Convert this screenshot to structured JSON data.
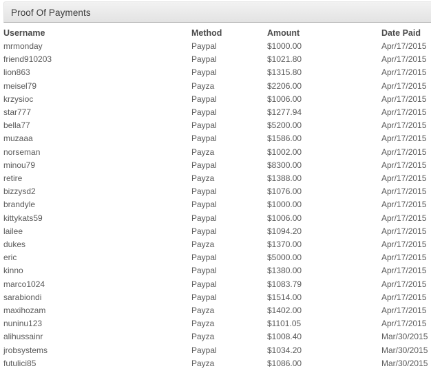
{
  "panel": {
    "title": "Proof Of Payments"
  },
  "table": {
    "headers": {
      "username": "Username",
      "method": "Method",
      "amount": "Amount",
      "date_paid": "Date Paid"
    },
    "rows": [
      {
        "username": "mrmonday",
        "method": "Paypal",
        "amount": "$1000.00",
        "date_paid": "Apr/17/2015"
      },
      {
        "username": "friend910203",
        "method": "Paypal",
        "amount": "$1021.80",
        "date_paid": "Apr/17/2015"
      },
      {
        "username": "lion863",
        "method": "Paypal",
        "amount": "$1315.80",
        "date_paid": "Apr/17/2015"
      },
      {
        "username": "meisel79",
        "method": "Payza",
        "amount": "$2206.00",
        "date_paid": "Apr/17/2015"
      },
      {
        "username": "krzysioc",
        "method": "Paypal",
        "amount": "$1006.00",
        "date_paid": "Apr/17/2015"
      },
      {
        "username": "star777",
        "method": "Paypal",
        "amount": "$1277.94",
        "date_paid": "Apr/17/2015"
      },
      {
        "username": "bella77",
        "method": "Paypal",
        "amount": "$5200.00",
        "date_paid": "Apr/17/2015"
      },
      {
        "username": "muzaaa",
        "method": "Paypal",
        "amount": "$1586.00",
        "date_paid": "Apr/17/2015"
      },
      {
        "username": "norseman",
        "method": "Payza",
        "amount": "$1002.00",
        "date_paid": "Apr/17/2015"
      },
      {
        "username": "minou79",
        "method": "Paypal",
        "amount": "$8300.00",
        "date_paid": "Apr/17/2015"
      },
      {
        "username": "retire",
        "method": "Payza",
        "amount": "$1388.00",
        "date_paid": "Apr/17/2015"
      },
      {
        "username": "bizzysd2",
        "method": "Paypal",
        "amount": "$1076.00",
        "date_paid": "Apr/17/2015"
      },
      {
        "username": "brandyle",
        "method": "Paypal",
        "amount": "$1000.00",
        "date_paid": "Apr/17/2015"
      },
      {
        "username": "kittykats59",
        "method": "Paypal",
        "amount": "$1006.00",
        "date_paid": "Apr/17/2015"
      },
      {
        "username": "lailee",
        "method": "Paypal",
        "amount": "$1094.20",
        "date_paid": "Apr/17/2015"
      },
      {
        "username": "dukes",
        "method": "Payza",
        "amount": "$1370.00",
        "date_paid": "Apr/17/2015"
      },
      {
        "username": "eric",
        "method": "Paypal",
        "amount": "$5000.00",
        "date_paid": "Apr/17/2015"
      },
      {
        "username": "kinno",
        "method": "Paypal",
        "amount": "$1380.00",
        "date_paid": "Apr/17/2015"
      },
      {
        "username": "marco1024",
        "method": "Paypal",
        "amount": "$1083.79",
        "date_paid": "Apr/17/2015"
      },
      {
        "username": "sarabiondi",
        "method": "Paypal",
        "amount": "$1514.00",
        "date_paid": "Apr/17/2015"
      },
      {
        "username": "maxihozam",
        "method": "Payza",
        "amount": "$1402.00",
        "date_paid": "Apr/17/2015"
      },
      {
        "username": "nuninu123",
        "method": "Payza",
        "amount": "$1101.05",
        "date_paid": "Apr/17/2015"
      },
      {
        "username": "alihussainr",
        "method": "Payza",
        "amount": "$1008.40",
        "date_paid": "Mar/30/2015"
      },
      {
        "username": "jrobsystems",
        "method": "Paypal",
        "amount": "$1034.20",
        "date_paid": "Mar/30/2015"
      },
      {
        "username": "futulici85",
        "method": "Payza",
        "amount": "$1086.00",
        "date_paid": "Mar/30/2015"
      }
    ]
  }
}
